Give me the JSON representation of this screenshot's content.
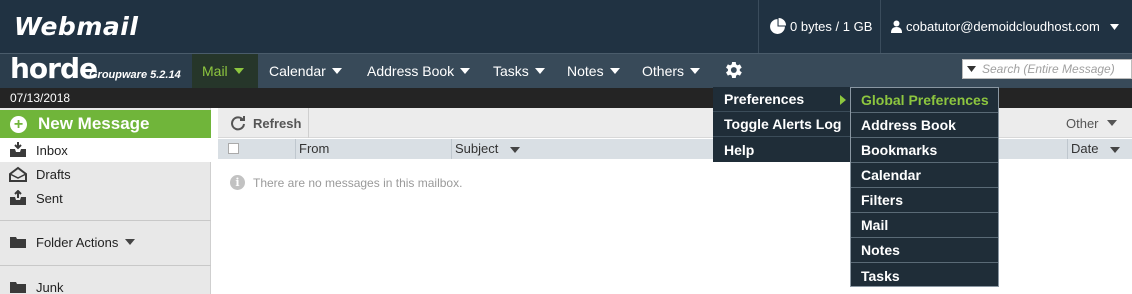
{
  "topbar": {
    "brand": "Webmail",
    "quota": "0 bytes / 1 GB",
    "user": "cobatutor@demoidcloudhost.com"
  },
  "navbar": {
    "logo": "horde",
    "version": "Groupware 5.2.14",
    "items": [
      {
        "label": "Mail",
        "active": true
      },
      {
        "label": "Calendar"
      },
      {
        "label": "Address Book"
      },
      {
        "label": "Tasks"
      },
      {
        "label": "Notes"
      },
      {
        "label": "Others"
      }
    ],
    "settings_icon": "gear-icon",
    "search_placeholder": "Search (Entire Message)"
  },
  "date": "07/13/2018",
  "sidebar": {
    "new_message": "New Message",
    "folders": [
      {
        "label": "Inbox",
        "icon": "inbox-icon",
        "selected": true
      },
      {
        "label": "Drafts",
        "icon": "drafts-icon"
      },
      {
        "label": "Sent",
        "icon": "sent-icon"
      }
    ],
    "folder_actions": "Folder Actions",
    "junk": "Junk"
  },
  "toolbar": {
    "refresh": "Refresh",
    "other": "Other"
  },
  "columns": {
    "from": "From",
    "subject": "Subject",
    "date": "Date"
  },
  "empty_message": "There are no messages in this mailbox.",
  "menus": {
    "settings": [
      "Preferences",
      "Toggle Alerts Log",
      "Help"
    ],
    "preferences": [
      "Global Preferences",
      "Address Book",
      "Bookmarks",
      "Calendar",
      "Filters",
      "Mail",
      "Notes",
      "Tasks"
    ]
  },
  "colors": {
    "accent_green": "#8dc63f",
    "new_message_green": "#70b53a",
    "topbar": "#203242",
    "navbar": "#384a59",
    "menu_bg": "#1f2d38"
  }
}
